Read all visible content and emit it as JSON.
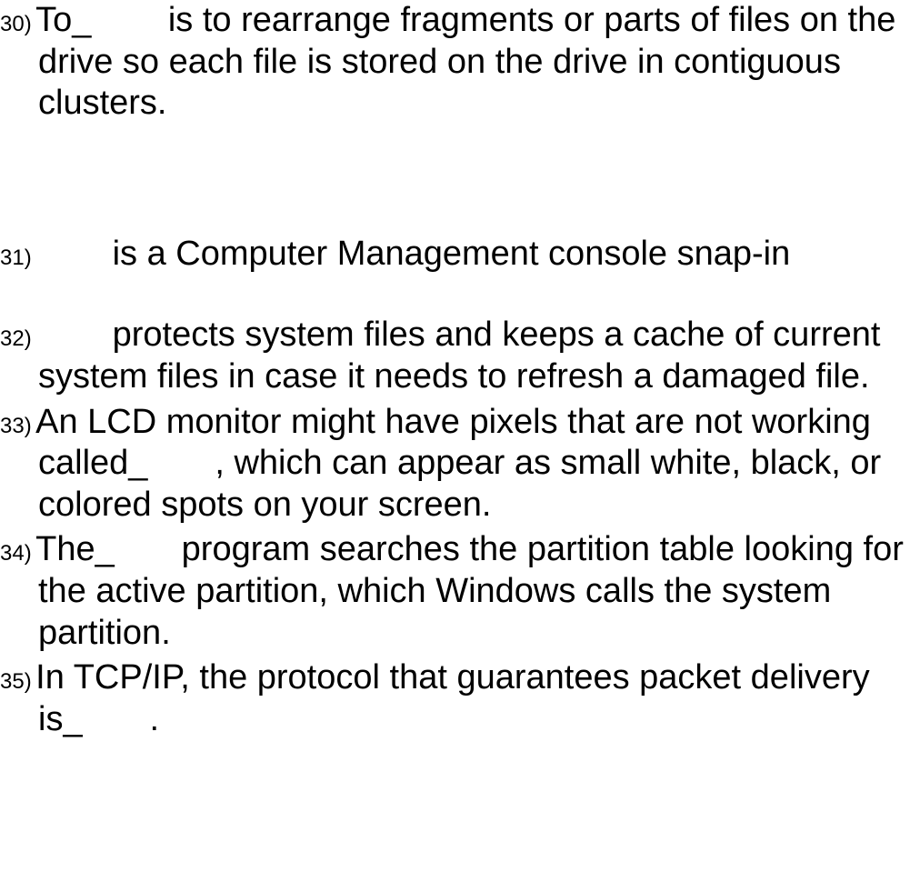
{
  "questions": [
    {
      "number": "30)",
      "text": "To_        is to rearrange fragments or parts of files on the drive so each file is stored on the drive in contiguous clusters."
    },
    {
      "number": "31)",
      "text": "        is a Computer Management console snap-in"
    },
    {
      "number": "32)",
      "text": "        protects system files and keeps a cache of current system files in case it needs to refresh a damaged file."
    },
    {
      "number": "33)",
      "text": "An LCD monitor might have pixels that are not working called_       , which can appear as small white, black, or colored spots on your screen."
    },
    {
      "number": "34)",
      "text": "The_       program searches the partition table looking for the active partition, which Windows calls the system partition."
    },
    {
      "number": "35)",
      "text": "In TCP/IP, the protocol that guarantees packet delivery is_       ."
    }
  ]
}
